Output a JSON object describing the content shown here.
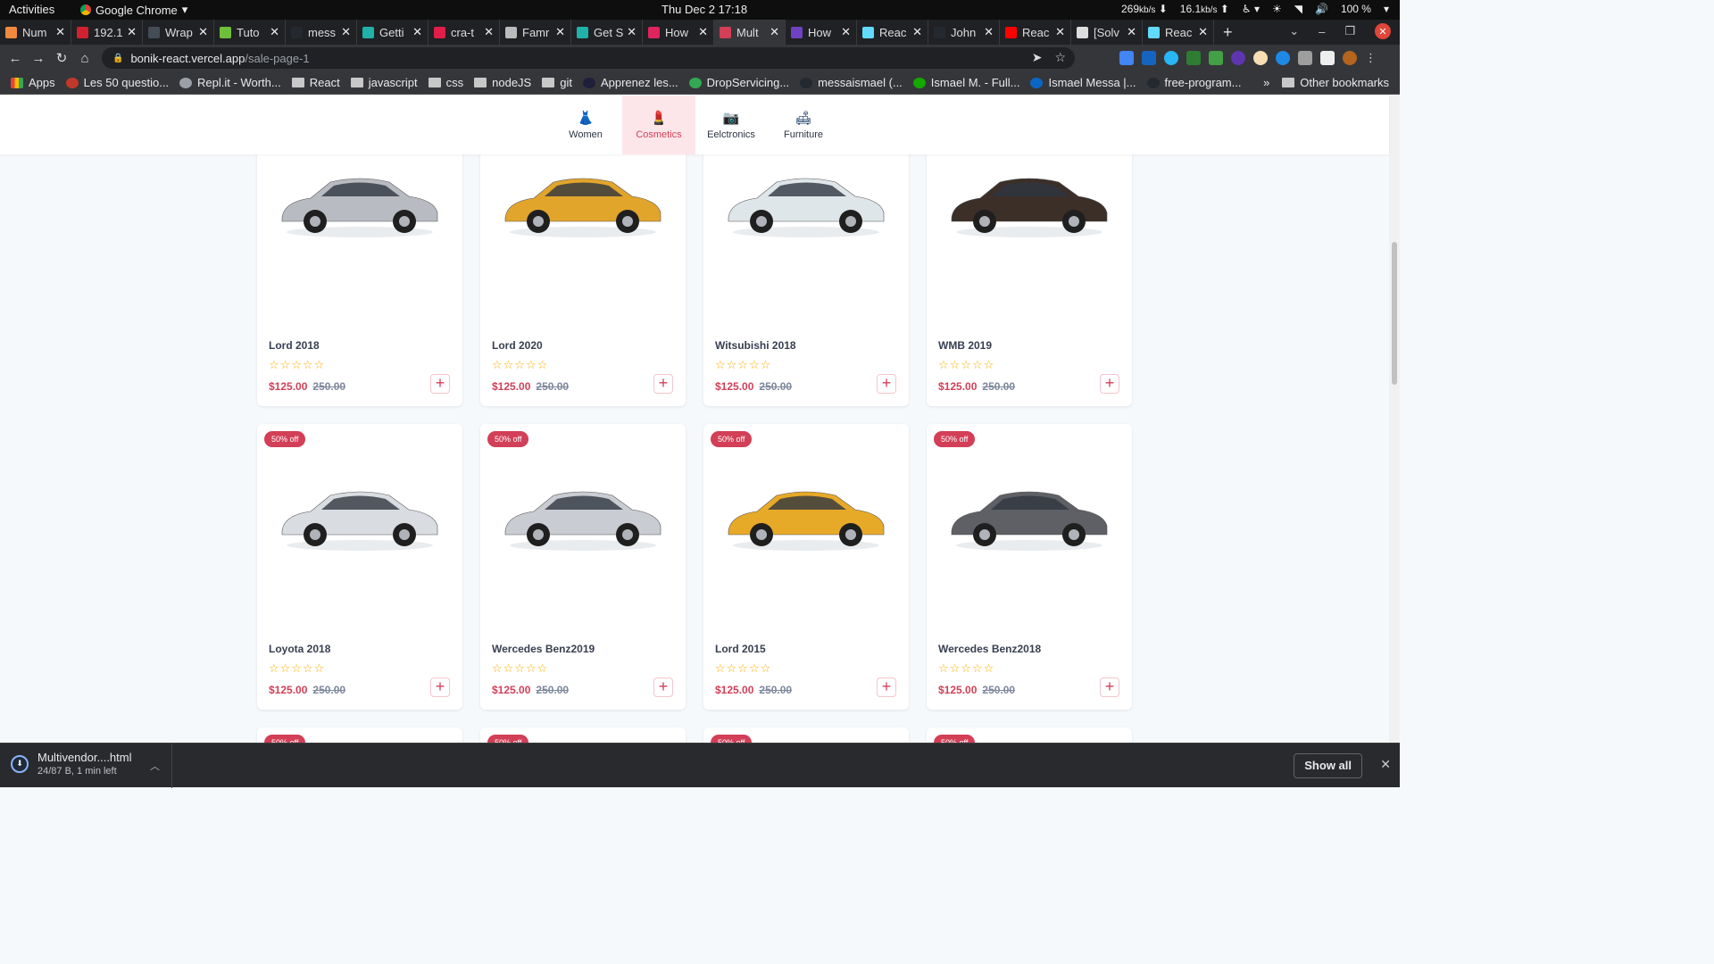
{
  "system": {
    "activities": "Activities",
    "app_name": "Google Chrome",
    "clock": "Thu Dec 2  17:18",
    "net_down": "269",
    "net_down_unit": "kb/s",
    "net_up": "16.1",
    "net_up_unit": "kb/s",
    "battery": "100 %"
  },
  "tabs": [
    {
      "title": "Num",
      "color": "#f0883e"
    },
    {
      "title": "192.1",
      "color": "#cf222e"
    },
    {
      "title": "Wrap",
      "color": "#444c56"
    },
    {
      "title": "Tuto",
      "color": "#6fbf3a"
    },
    {
      "title": "mess",
      "color": "#24292f"
    },
    {
      "title": "Getti",
      "color": "#20b2aa"
    },
    {
      "title": "cra-t",
      "color": "#e11d48"
    },
    {
      "title": "Famr",
      "color": "#bbbbbb"
    },
    {
      "title": "Get S",
      "color": "#20b2aa"
    },
    {
      "title": "How",
      "color": "#e0245e"
    },
    {
      "title": "Mult",
      "color": "#d23f57",
      "active": true
    },
    {
      "title": "How",
      "color": "#6f42c1"
    },
    {
      "title": "Reac",
      "color": "#61dafb"
    },
    {
      "title": "John",
      "color": "#24292f"
    },
    {
      "title": "Reac",
      "color": "#ff0000"
    },
    {
      "title": "[Solv",
      "color": "#dddddd"
    },
    {
      "title": "Reac",
      "color": "#61dafb"
    }
  ],
  "address": {
    "domain": "bonik-react.vercel.app",
    "path": "/sale-page-1"
  },
  "bookmarks": [
    {
      "label": "Apps",
      "kind": "apps"
    },
    {
      "label": "Les 50 questio...",
      "kind": "icon",
      "color": "#c0392b"
    },
    {
      "label": "Repl.it - Worth...",
      "kind": "icon",
      "color": "#9aa0a6"
    },
    {
      "label": "React",
      "kind": "folder"
    },
    {
      "label": "javascript",
      "kind": "folder"
    },
    {
      "label": "css",
      "kind": "folder"
    },
    {
      "label": "nodeJS",
      "kind": "folder"
    },
    {
      "label": "git",
      "kind": "folder"
    },
    {
      "label": "Apprenez les...",
      "kind": "icon",
      "color": "#1f1f3a"
    },
    {
      "label": "DropServicing...",
      "kind": "icon",
      "color": "#34a853"
    },
    {
      "label": "messaismael (...",
      "kind": "icon",
      "color": "#24292f"
    },
    {
      "label": "Ismael M. - Full...",
      "kind": "icon",
      "color": "#14a800"
    },
    {
      "label": "Ismael Messa |...",
      "kind": "icon",
      "color": "#0a66c2"
    },
    {
      "label": "free-program...",
      "kind": "icon",
      "color": "#24292f"
    }
  ],
  "bookmarks_more": "»",
  "other_bookmarks": "Other bookmarks",
  "categories": [
    {
      "label": "Women",
      "icon": "dress-icon",
      "glyph": "👗"
    },
    {
      "label": "Cosmetics",
      "icon": "lipstick-icon",
      "glyph": "💄",
      "active": true
    },
    {
      "label": "Eelctronics",
      "icon": "camera-icon",
      "glyph": "📷"
    },
    {
      "label": "Furniture",
      "icon": "sofa-icon",
      "glyph": "🛋"
    }
  ],
  "products": [
    {
      "name": "Lord 2018",
      "price": "$125.00",
      "old_price": "250.00",
      "rating": 0,
      "color": "#b8bcc2"
    },
    {
      "name": "Lord 2020",
      "price": "$125.00",
      "old_price": "250.00",
      "rating": 0,
      "color": "#e2a52c"
    },
    {
      "name": "Witsubishi 2018",
      "price": "$125.00",
      "old_price": "250.00",
      "rating": 0,
      "color": "#dfe6ea"
    },
    {
      "name": "WMB 2019",
      "price": "$125.00",
      "old_price": "250.00",
      "rating": 0,
      "color": "#3b2f28"
    },
    {
      "name": "Loyota 2018",
      "price": "$125.00",
      "old_price": "250.00",
      "rating": 0,
      "badge": "50% off",
      "color": "#d9dde2"
    },
    {
      "name": "Wercedes Benz2019",
      "price": "$125.00",
      "old_price": "250.00",
      "rating": 0,
      "badge": "50% off",
      "color": "#c9ccd2"
    },
    {
      "name": "Lord 2015",
      "price": "$125.00",
      "old_price": "250.00",
      "rating": 0,
      "badge": "50% off",
      "color": "#e7a928"
    },
    {
      "name": "Wercedes Benz2018",
      "price": "$125.00",
      "old_price": "250.00",
      "rating": 0,
      "badge": "50% off",
      "color": "#5e6066"
    }
  ],
  "stars": "☆☆☆☆☆",
  "add_glyph": "+",
  "next_row_badge": "50% off",
  "download": {
    "filename": "Multivendor....html",
    "status": "24/87 B, 1 min left",
    "show_all": "Show all"
  },
  "colors": {
    "accent": "#d23f57",
    "accent_light": "#fde6ea",
    "star": "#faaf00"
  }
}
